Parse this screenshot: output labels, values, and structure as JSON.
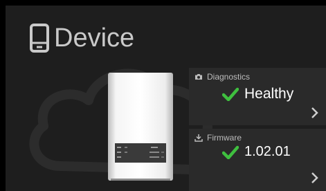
{
  "header": {
    "title": "Device",
    "icon": "device-icon"
  },
  "diagnostics": {
    "label": "Diagnostics",
    "status": "Healthy",
    "label_icon": "camera-icon",
    "status_icon": "checkmark-icon"
  },
  "firmware": {
    "label": "Firmware",
    "version": "1.02.01",
    "label_icon": "download-icon",
    "status_icon": "checkmark-icon"
  },
  "colors": {
    "background": "#1e1e1e",
    "card": "#2a2a2a",
    "accent_green": "#3fbf3f",
    "text": "#ffffff",
    "muted_text": "#bdbdbd"
  }
}
